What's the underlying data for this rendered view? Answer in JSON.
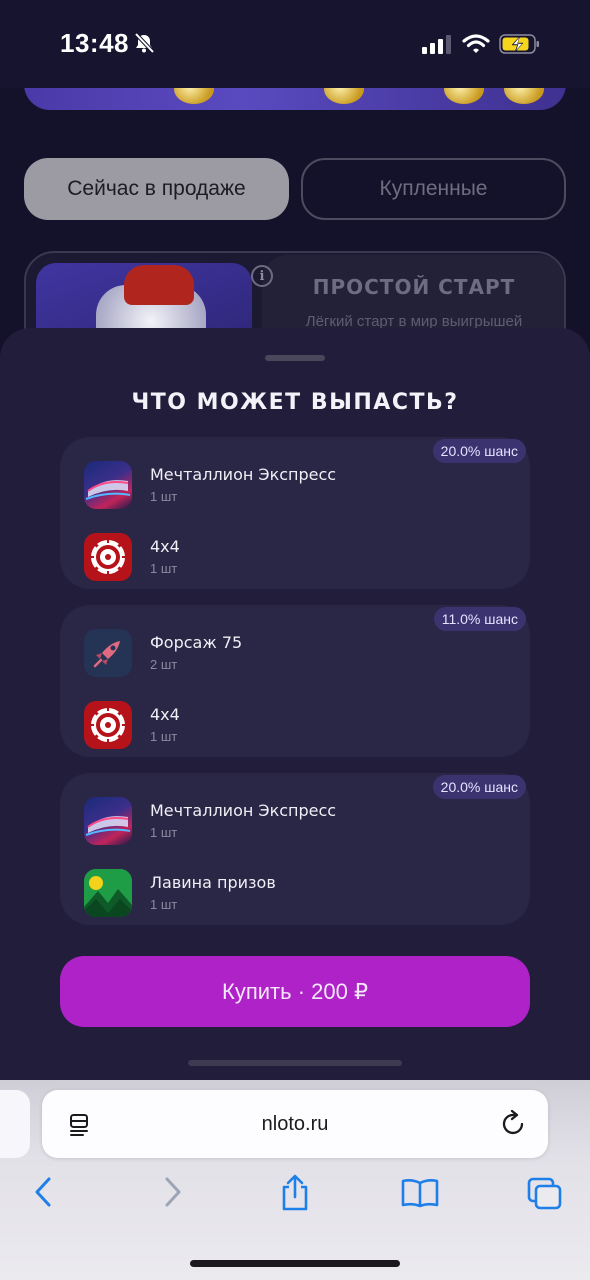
{
  "status_bar": {
    "time": "13:48"
  },
  "tabs": {
    "on_sale": "Сейчас в продаже",
    "purchased": "Купленные"
  },
  "card": {
    "info": "i",
    "title": "ПРОСТОЙ СТАРТ",
    "subtitle": "Лёгкий старт в мир выигрышей"
  },
  "sheet": {
    "title": "ЧТО МОЖЕТ ВЫПАСТЬ?",
    "groups": [
      {
        "chance": "20.0% шанс",
        "prizes": [
          {
            "name": "Мечталлион Экспресс",
            "qty": "1 шт",
            "icon": "express-train-icon"
          },
          {
            "name": "4x4",
            "qty": "1 шт",
            "icon": "wheel-icon"
          }
        ]
      },
      {
        "chance": "11.0% шанс",
        "prizes": [
          {
            "name": "Форсаж 75",
            "qty": "2 шт",
            "icon": "rocket-icon"
          },
          {
            "name": "4x4",
            "qty": "1 шт",
            "icon": "wheel-icon"
          }
        ]
      },
      {
        "chance": "20.0% шанс",
        "prizes": [
          {
            "name": "Мечталлион Экспресс",
            "qty": "1 шт",
            "icon": "express-train-icon"
          },
          {
            "name": "Лавина призов",
            "qty": "1 шт",
            "icon": "mountain-sun-icon"
          }
        ]
      }
    ],
    "buy_label": "Купить · 200 ₽"
  },
  "browser": {
    "url": "nloto.ru"
  },
  "colors": {
    "accent": "#ae22c8",
    "sheet": "#211d3a",
    "chance_badge": "#3b3370"
  }
}
